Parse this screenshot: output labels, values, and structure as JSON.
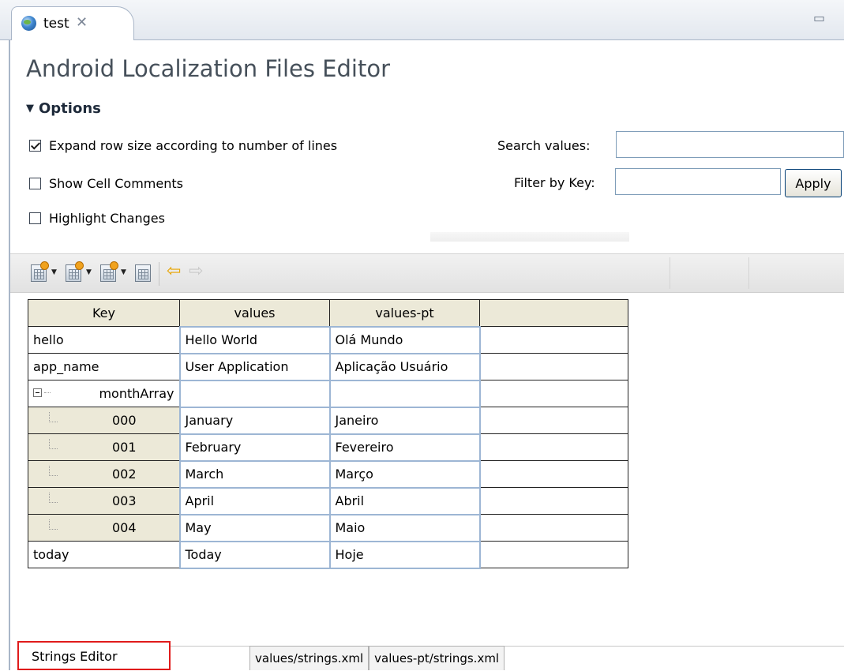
{
  "editor_tab": {
    "title": "test",
    "close_icon": "close-icon",
    "file_icon": "globe-icon"
  },
  "form": {
    "title": "Android Localization Files Editor",
    "options_section": "Options",
    "options": [
      {
        "label": "Expand row size according to number of lines",
        "checked": true
      },
      {
        "label": "Show Cell Comments",
        "checked": false
      },
      {
        "label": "Highlight Changes",
        "checked": false
      }
    ],
    "search_label": "Search values:",
    "search_value": "",
    "filter_label": "Filter by Key:",
    "filter_value": "",
    "apply_label": "Apply"
  },
  "toolbar": {
    "icons": [
      "add-key-icon",
      "add-array-icon",
      "add-language-icon",
      "remove-icon"
    ],
    "back_icon": "back-arrow-icon",
    "forward_icon": "forward-arrow-icon"
  },
  "table": {
    "headers": [
      "Key",
      "values",
      "values-pt",
      ""
    ],
    "rows": [
      {
        "key": "hello",
        "values": "Hello World",
        "values_pt": "Olá Mundo"
      },
      {
        "key": "app_name",
        "values": "User Application",
        "values_pt": "Aplicação Usuário"
      },
      {
        "key": "monthArray",
        "values": "",
        "values_pt": ""
      },
      {
        "key": "000",
        "values": "January",
        "values_pt": "Janeiro"
      },
      {
        "key": "001",
        "values": "February",
        "values_pt": "Fevereiro"
      },
      {
        "key": "002",
        "values": "March",
        "values_pt": "Março"
      },
      {
        "key": "003",
        "values": "April",
        "values_pt": "Abril"
      },
      {
        "key": "004",
        "values": "May",
        "values_pt": "Maio"
      },
      {
        "key": "today",
        "values": "Today",
        "values_pt": "Hoje"
      }
    ]
  },
  "page_tabs": {
    "active": "Strings Editor",
    "files": [
      "values/strings.xml",
      "values-pt/strings.xml"
    ]
  },
  "colors": {
    "highlight_border": "#e01b1b",
    "table_header_bg": "#ece9d8",
    "value_cell_border": "#9db6d4"
  }
}
